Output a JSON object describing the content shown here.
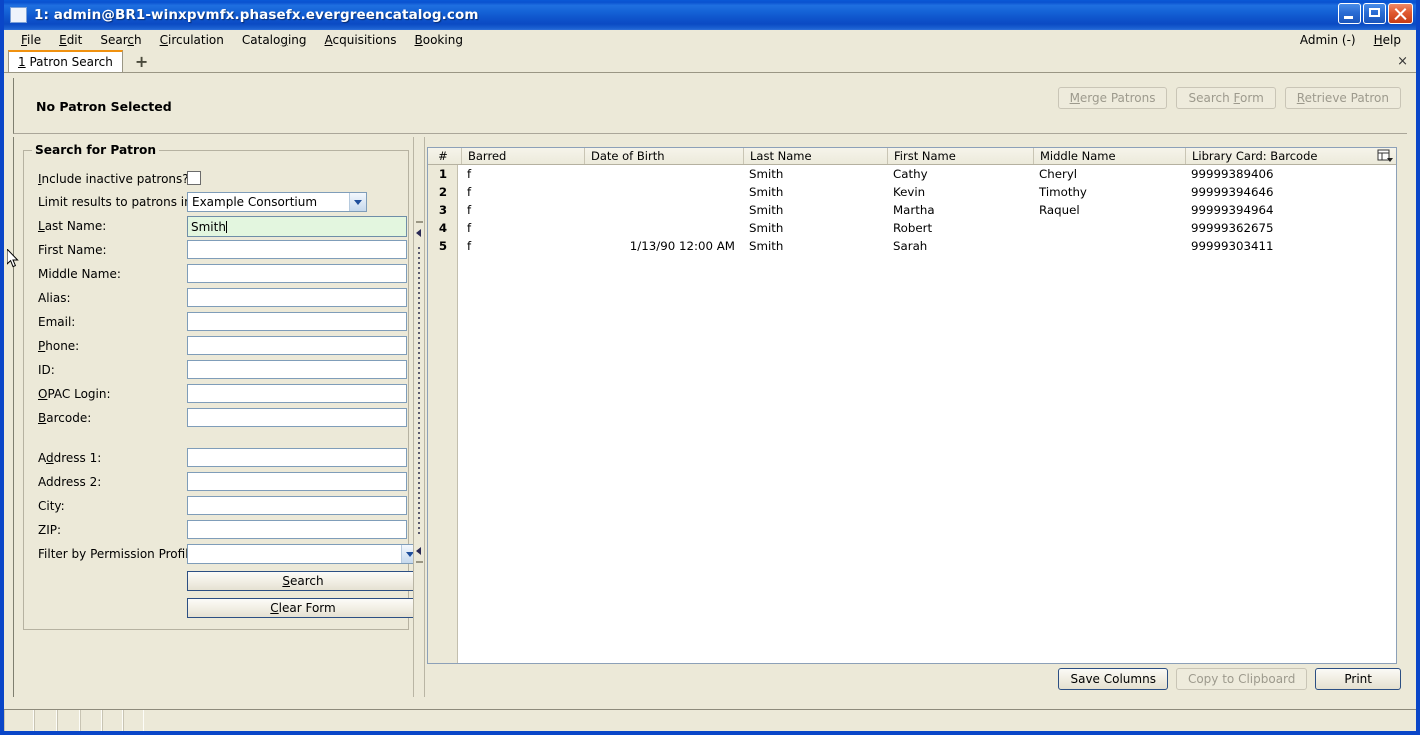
{
  "window": {
    "title": "1: admin@BR1-winxpvmfx.phasefx.evergreencatalog.com",
    "icon": "app-icon",
    "minimize_label": "Minimize",
    "maximize_label": "Maximize",
    "close_label": "Close"
  },
  "menubar": {
    "items": [
      {
        "label": "File",
        "accel": "F"
      },
      {
        "label": "Edit",
        "accel": "E"
      },
      {
        "label": "Search",
        "accel": "c"
      },
      {
        "label": "Circulation",
        "accel": "C"
      },
      {
        "label": "Cataloging",
        "accel": "g"
      },
      {
        "label": "Acquisitions",
        "accel": "A"
      },
      {
        "label": "Booking",
        "accel": "B"
      }
    ],
    "right_items": [
      {
        "label": "Admin (-)"
      },
      {
        "label": "Help",
        "accel": "H"
      }
    ]
  },
  "tabs": {
    "active": "1 Patron Search",
    "new_tab_label": "+",
    "close_label": "×"
  },
  "patron_header": {
    "title": "No Patron Selected",
    "buttons": [
      {
        "label": "Merge Patrons",
        "enabled": false
      },
      {
        "label": "Search Form",
        "enabled": false
      },
      {
        "label": "Retrieve Patron",
        "enabled": false
      }
    ]
  },
  "search_form": {
    "legend": "Search for Patron",
    "fields": [
      {
        "label": "Include inactive patrons?",
        "type": "checkbox",
        "checked": false,
        "value": ""
      },
      {
        "label": "Limit results to patrons in",
        "type": "select",
        "value": "Example Consortium"
      },
      {
        "label": "Last Name:",
        "type": "text",
        "value": "Smith",
        "focused": true
      },
      {
        "label": "First Name:",
        "type": "text",
        "value": ""
      },
      {
        "label": "Middle Name:",
        "type": "text",
        "value": ""
      },
      {
        "label": "Alias:",
        "type": "text",
        "value": ""
      },
      {
        "label": "Email:",
        "type": "text",
        "value": ""
      },
      {
        "label": "Phone:",
        "type": "text",
        "value": ""
      },
      {
        "label": "ID:",
        "type": "text",
        "value": ""
      },
      {
        "label": "OPAC Login:",
        "type": "text",
        "value": ""
      },
      {
        "label": "Barcode:",
        "type": "text",
        "value": ""
      },
      {
        "label": "Address 1:",
        "type": "text",
        "value": ""
      },
      {
        "label": "Address 2:",
        "type": "text",
        "value": ""
      },
      {
        "label": "City:",
        "type": "text",
        "value": ""
      },
      {
        "label": "ZIP:",
        "type": "text",
        "value": ""
      },
      {
        "label": "Filter by Permission Profile:",
        "type": "select",
        "value": ""
      }
    ],
    "search_button": "Search",
    "clear_button": "Clear Form"
  },
  "results_grid": {
    "columns": [
      "#",
      "Barred",
      "Date of Birth",
      "Last Name",
      "First Name",
      "Middle Name",
      "Library Card: Barcode"
    ],
    "column_picker_icon": "column-picker-icon",
    "rows": [
      {
        "num": "1",
        "barred": "f",
        "dob": "",
        "last": "Smith",
        "first": "Cathy",
        "middle": "Cheryl",
        "barcode": "99999389406"
      },
      {
        "num": "2",
        "barred": "f",
        "dob": "",
        "last": "Smith",
        "first": "Kevin",
        "middle": "Timothy",
        "barcode": "99999394646"
      },
      {
        "num": "3",
        "barred": "f",
        "dob": "",
        "last": "Smith",
        "first": "Martha",
        "middle": "Raquel",
        "barcode": "99999394964"
      },
      {
        "num": "4",
        "barred": "f",
        "dob": "",
        "last": "Smith",
        "first": "Robert",
        "middle": "",
        "barcode": "99999362675"
      },
      {
        "num": "5",
        "barred": "f",
        "dob": "1/13/90 12:00 AM",
        "last": "Smith",
        "first": "Sarah",
        "middle": "",
        "barcode": "99999303411"
      }
    ],
    "buttons": [
      {
        "label": "Save Columns",
        "enabled": true
      },
      {
        "label": "Copy to Clipboard",
        "enabled": false
      },
      {
        "label": "Print",
        "enabled": true
      }
    ]
  },
  "colors": {
    "titlebar_blue": "#0a52d0",
    "window_border": "#0a46c8",
    "chrome_beige": "#ece9d8",
    "focused_field_green": "#e3f6df",
    "active_tab_accent": "#f0910f",
    "default_button_border": "#2c4f83"
  }
}
